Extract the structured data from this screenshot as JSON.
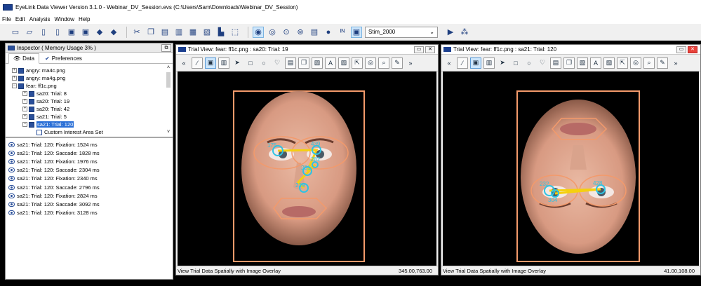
{
  "window_title": "EyeLink Data Viewer Version 3.1.0 - Webinar_DV_Session.evs (C:\\Users\\Sam\\Downloads\\Webinar_DV_Session)",
  "menu": [
    "File",
    "Edit",
    "Analysis",
    "Window",
    "Help"
  ],
  "toolbar": {
    "stim_select": "Stim_2000"
  },
  "inspector": {
    "title": "Inspector ( Memory Usage 3% )",
    "tabs": [
      "Data",
      "Preferences"
    ],
    "tree": [
      {
        "label": "angry: ma4c.png"
      },
      {
        "label": "angry: ma4g.png"
      },
      {
        "label": "fear: ff1c.png"
      },
      {
        "label": "sa20: Trial: 8"
      },
      {
        "label": "sa20: Trial: 19"
      },
      {
        "label": "sa20: Trial: 42"
      },
      {
        "label": "sa21: Trial: 5"
      },
      {
        "label": "sa21: Trial: 120"
      },
      {
        "label": "Custom Interest Area Set"
      }
    ],
    "events": [
      "sa21: Trial: 120: Fixation: 1524 ms",
      "sa21: Trial: 120: Saccade: 1828 ms",
      "sa21: Trial: 120: Fixation: 1976 ms",
      "sa21: Trial: 120: Saccade: 2304 ms",
      "sa21: Trial: 120: Fixation: 2340 ms",
      "sa21: Trial: 120: Saccade: 2796 ms",
      "sa21: Trial: 120: Fixation: 2824 ms",
      "sa21: Trial: 120: Saccade: 3092 ms",
      "sa21: Trial: 120: Fixation: 3128 ms"
    ]
  },
  "trial_view_1": {
    "title": "Trial View: fear: ff1c.png : sa20: Trial: 19",
    "status_left": "View Trial Data Spatially with Image Overlay",
    "status_right": "345.00,763.00",
    "fix_labels": [
      "175",
      "439",
      "231",
      "282",
      "229"
    ]
  },
  "trial_view_2": {
    "title": "Trial View: fear: ff1c.png : sa21: Trial: 120",
    "status_left": "View Trial Data Spatially with Image Overlay",
    "status_right": "41.00,108.00",
    "fix_labels": [
      "232",
      "304",
      "428"
    ]
  },
  "colors": {
    "interest_area": "#f39a6b",
    "scanpath": "#f5d00f",
    "fixation": "#2ec3e3"
  }
}
